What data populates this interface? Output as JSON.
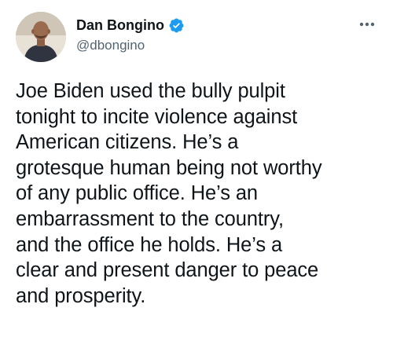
{
  "author": {
    "display_name": "Dan Bongino",
    "handle": "@dbongino",
    "verified": true,
    "avatar_icon": "profile-photo"
  },
  "icons": {
    "verified": "verified-badge-icon",
    "more": "more-options-icon"
  },
  "colors": {
    "verified_badge": "#1d9bf0",
    "text_primary": "#0f1419",
    "text_secondary": "#536471"
  },
  "tweet": {
    "text": "Joe Biden used the bully pulpit\ntonight to incite violence against\nAmerican citizens. He’s a\ngrotesque human being not worthy\nof any public office. He’s an\nembarrassment to the country,\nand the office he holds. He’s a\nclear and present danger to peace\nand prosperity."
  }
}
